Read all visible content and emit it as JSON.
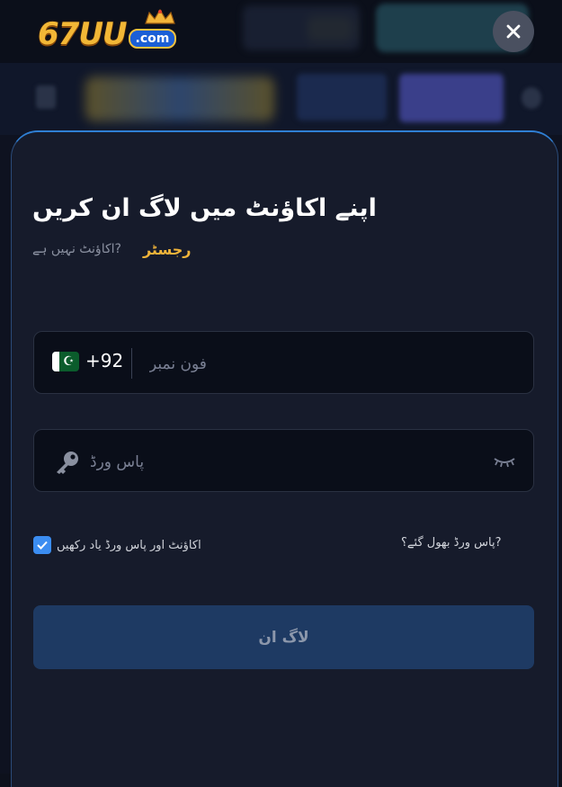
{
  "brand": {
    "logo_text": "67UU",
    "logo_suffix": ".com"
  },
  "login": {
    "title": "اپنے اکاؤنٹ میں لاگ ان کریں",
    "no_account_text": "?اکاؤنٹ نہیں ہے",
    "register_link": "رجسٹر",
    "phone": {
      "country_code": "+92",
      "flag": "pakistan-flag",
      "placeholder": "فون نمبر",
      "value": ""
    },
    "password": {
      "placeholder": "پاس ورڈ",
      "value": ""
    },
    "remember_label": "اکاؤنٹ اور پاس ورڈ یاد رکھیں",
    "remember_checked": true,
    "forgot_link": "?پاس ورڈ بھول گئے؟",
    "submit_label": "لاگ ان"
  },
  "colors": {
    "accent": "#f0b43a",
    "checkbox": "#3b8df1",
    "button": "#1e3a63",
    "panel": "#161b2b"
  }
}
